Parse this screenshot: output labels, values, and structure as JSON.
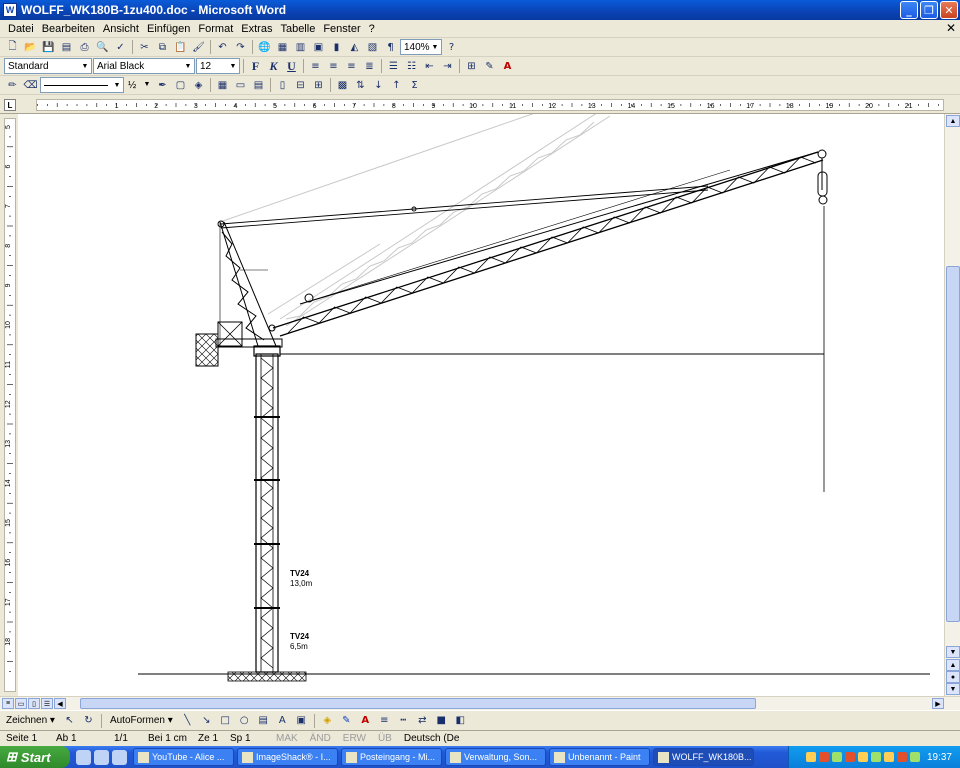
{
  "window": {
    "title": "WOLFF_WK180B-1zu400.doc - Microsoft Word",
    "app_icon": "W"
  },
  "menu": [
    "Datei",
    "Bearbeiten",
    "Ansicht",
    "Einfügen",
    "Format",
    "Extras",
    "Tabelle",
    "Fenster",
    "?"
  ],
  "toolbar": {
    "zoom": "140%",
    "style": "Standard",
    "font": "Arial Black",
    "size": "12",
    "bold": "F",
    "italic": "K",
    "underline": "U",
    "line_width": "½"
  },
  "ruler": {
    "h_labels": [
      "1",
      "2",
      "3",
      "4",
      "5",
      "6",
      "7",
      "8",
      "9",
      "10",
      "11",
      "12",
      "13",
      "14",
      "15",
      "16",
      "17",
      "18",
      "19",
      "20",
      "21",
      "22"
    ],
    "v_labels": [
      "5",
      "6",
      "7",
      "8",
      "9",
      "10",
      "11",
      "12",
      "13",
      "14",
      "15",
      "16",
      "17",
      "18"
    ]
  },
  "drawing": {
    "labels": [
      {
        "title": "TV24",
        "value": "13,0m"
      },
      {
        "title": "TV24",
        "value": "6,5m"
      }
    ]
  },
  "drawtoolbar": {
    "draw_label": "Zeichnen ▾",
    "autoshapes_label": "AutoFormen ▾"
  },
  "status": {
    "page": "Seite 1",
    "section": "Ab 1",
    "pages": "1/1",
    "at": "Bei 1 cm",
    "line": "Ze 1",
    "col": "Sp 1",
    "mak": "MAK",
    "and": "ÄND",
    "erw": "ERW",
    "ub": "ÜB",
    "language": "Deutsch (De"
  },
  "taskbar": {
    "start": "Start",
    "tasks": [
      {
        "label": "YouTube - Alice ...",
        "active": false
      },
      {
        "label": "ImageShack® - I...",
        "active": false
      },
      {
        "label": "Posteingang - Mi...",
        "active": false
      },
      {
        "label": "Verwaltung, Son...",
        "active": false
      },
      {
        "label": "Unbenannt - Paint",
        "active": false
      },
      {
        "label": "WOLFF_WK180B...",
        "active": true
      }
    ],
    "clock": "19:37"
  }
}
